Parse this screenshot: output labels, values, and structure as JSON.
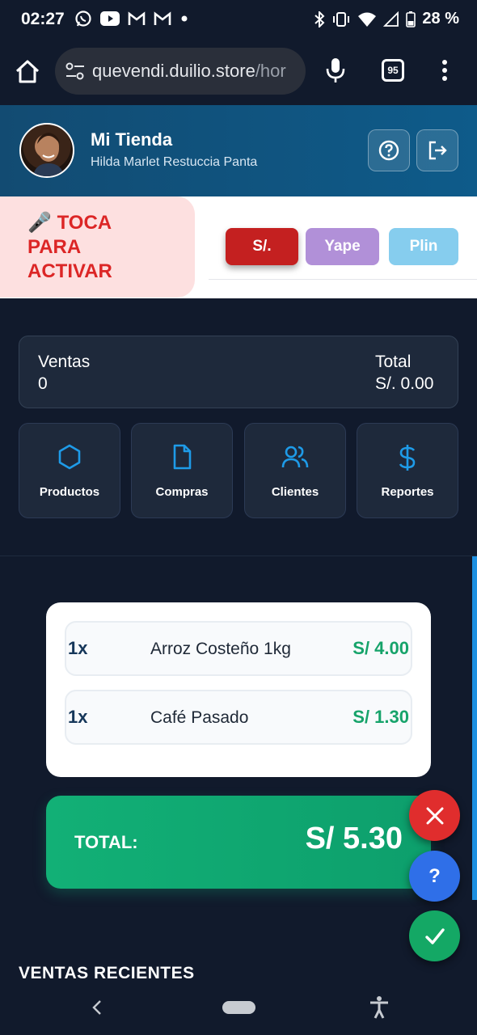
{
  "status_bar": {
    "time": "02:27",
    "battery": "28 %",
    "left_icons": [
      "whatsapp-icon",
      "youtube-icon",
      "gmail-icon",
      "gmail-icon",
      "dot-icon"
    ],
    "right_icons": [
      "bluetooth-icon",
      "vibrate-icon",
      "wifi-icon",
      "signal-icon",
      "battery-icon"
    ]
  },
  "browser": {
    "url_main": "quevendi.duilio.store",
    "url_rest": "/hor",
    "tab_count": "95"
  },
  "header": {
    "shop_name": "Mi Tienda",
    "owner_name": "Hilda Marlet Restuccia Panta"
  },
  "voice": {
    "emoji": "🎤",
    "line1": "TOCA",
    "line2": "PARA",
    "line3": "ACTIVAR"
  },
  "payment_methods": [
    "S/.",
    "Yape",
    "Plin"
  ],
  "summary": {
    "ventas_label": "Ventas",
    "ventas_value": "0",
    "total_label": "Total",
    "total_value": "S/. 0.00"
  },
  "quick_actions": [
    "Productos",
    "Compras",
    "Clientes",
    "Reportes"
  ],
  "cart": {
    "items": [
      {
        "qty": "1x",
        "name": "Arroz Costeño 1kg",
        "price": "S/ 4.00"
      },
      {
        "qty": "1x",
        "name": "Café Pasado",
        "price": "S/ 1.30"
      }
    ],
    "total_label": "TOTAL:",
    "total_value": "S/ 5.30"
  },
  "fab": {
    "help_label": "?"
  },
  "recent_sales_title": "VENTAS RECIENTES",
  "colors": {
    "background": "#111a2c",
    "header": "#124b72",
    "accent_red": "#c42020",
    "yape": "#b190d8",
    "plin": "#86cdee",
    "total_green": "#12b076",
    "price_green": "#16a36a"
  }
}
